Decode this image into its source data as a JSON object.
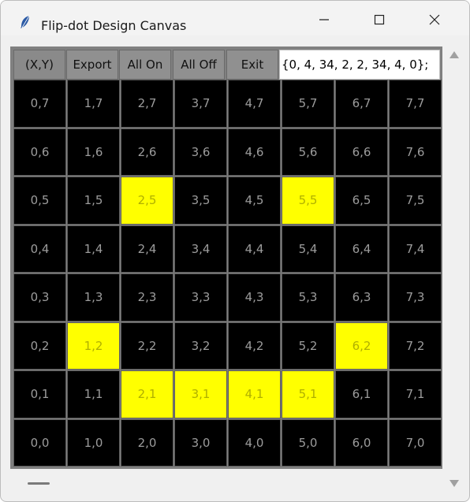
{
  "window": {
    "title": "Flip-dot Design Canvas"
  },
  "toolbar": {
    "xy_label": "(X,Y)",
    "export_label": "Export",
    "all_on_label": "All On",
    "all_off_label": "All Off",
    "exit_label": "Exit",
    "export_output": "{0, 4, 34, 2, 2, 34, 4, 0};"
  },
  "grid": {
    "on_color": "#ffff00",
    "off_color": "#000000",
    "rows": [
      {
        "y": 7,
        "cells": [
          {
            "label": "0,7",
            "on": false
          },
          {
            "label": "1,7",
            "on": false
          },
          {
            "label": "2,7",
            "on": false
          },
          {
            "label": "3,7",
            "on": false
          },
          {
            "label": "4,7",
            "on": false
          },
          {
            "label": "5,7",
            "on": false
          },
          {
            "label": "6,7",
            "on": false
          },
          {
            "label": "7,7",
            "on": false
          }
        ]
      },
      {
        "y": 6,
        "cells": [
          {
            "label": "0,6",
            "on": false
          },
          {
            "label": "1,6",
            "on": false
          },
          {
            "label": "2,6",
            "on": false
          },
          {
            "label": "3,6",
            "on": false
          },
          {
            "label": "4,6",
            "on": false
          },
          {
            "label": "5,6",
            "on": false
          },
          {
            "label": "6,6",
            "on": false
          },
          {
            "label": "7,6",
            "on": false
          }
        ]
      },
      {
        "y": 5,
        "cells": [
          {
            "label": "0,5",
            "on": false
          },
          {
            "label": "1,5",
            "on": false
          },
          {
            "label": "2,5",
            "on": true
          },
          {
            "label": "3,5",
            "on": false
          },
          {
            "label": "4,5",
            "on": false
          },
          {
            "label": "5,5",
            "on": true
          },
          {
            "label": "6,5",
            "on": false
          },
          {
            "label": "7,5",
            "on": false
          }
        ]
      },
      {
        "y": 4,
        "cells": [
          {
            "label": "0,4",
            "on": false
          },
          {
            "label": "1,4",
            "on": false
          },
          {
            "label": "2,4",
            "on": false
          },
          {
            "label": "3,4",
            "on": false
          },
          {
            "label": "4,4",
            "on": false
          },
          {
            "label": "5,4",
            "on": false
          },
          {
            "label": "6,4",
            "on": false
          },
          {
            "label": "7,4",
            "on": false
          }
        ]
      },
      {
        "y": 3,
        "cells": [
          {
            "label": "0,3",
            "on": false
          },
          {
            "label": "1,3",
            "on": false
          },
          {
            "label": "2,3",
            "on": false
          },
          {
            "label": "3,3",
            "on": false
          },
          {
            "label": "4,3",
            "on": false
          },
          {
            "label": "5,3",
            "on": false
          },
          {
            "label": "6,3",
            "on": false
          },
          {
            "label": "7,3",
            "on": false
          }
        ]
      },
      {
        "y": 2,
        "cells": [
          {
            "label": "0,2",
            "on": false
          },
          {
            "label": "1,2",
            "on": true
          },
          {
            "label": "2,2",
            "on": false
          },
          {
            "label": "3,2",
            "on": false
          },
          {
            "label": "4,2",
            "on": false
          },
          {
            "label": "5,2",
            "on": false
          },
          {
            "label": "6,2",
            "on": true
          },
          {
            "label": "7,2",
            "on": false
          }
        ]
      },
      {
        "y": 1,
        "cells": [
          {
            "label": "0,1",
            "on": false
          },
          {
            "label": "1,1",
            "on": false
          },
          {
            "label": "2,1",
            "on": true
          },
          {
            "label": "3,1",
            "on": true
          },
          {
            "label": "4,1",
            "on": true
          },
          {
            "label": "5,1",
            "on": true
          },
          {
            "label": "6,1",
            "on": false
          },
          {
            "label": "7,1",
            "on": false
          }
        ]
      },
      {
        "y": 0,
        "cells": [
          {
            "label": "0,0",
            "on": false
          },
          {
            "label": "1,0",
            "on": false
          },
          {
            "label": "2,0",
            "on": false
          },
          {
            "label": "3,0",
            "on": false
          },
          {
            "label": "4,0",
            "on": false
          },
          {
            "label": "5,0",
            "on": false
          },
          {
            "label": "6,0",
            "on": false
          },
          {
            "label": "7,0",
            "on": false
          }
        ]
      }
    ]
  }
}
